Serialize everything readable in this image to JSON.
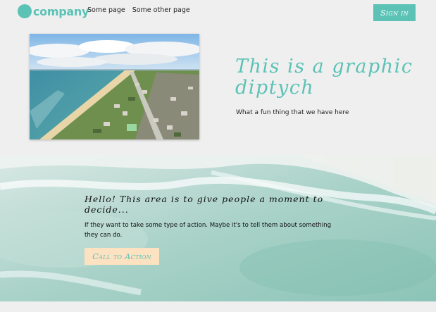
{
  "header": {
    "logo_text": "company",
    "nav": [
      "Some page",
      "Some other page"
    ],
    "signin_label": "Sign in"
  },
  "diptych": {
    "title": "This is a graphic diptych",
    "subtitle": "What a fun thing that we have here"
  },
  "callout": {
    "title": "Hello! This area is to give people a moment to decide...",
    "body": "If they want to take some type of action. Maybe it's to tell them about something they can do.",
    "cta_label": "Call to Action"
  },
  "colors": {
    "accent": "#5bc2b5",
    "cta_background": "#fde2c2",
    "page_background": "#efefef"
  },
  "icons": {
    "logo": "teal-circle-icon"
  }
}
